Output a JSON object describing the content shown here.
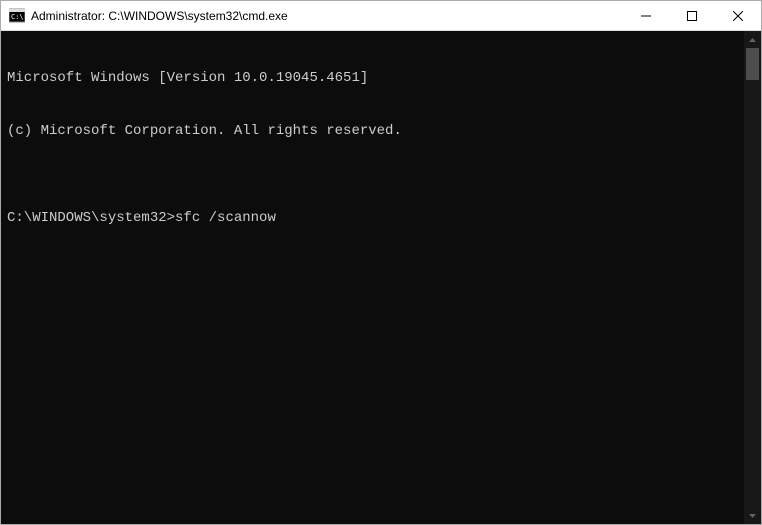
{
  "titlebar": {
    "title": "Administrator: C:\\WINDOWS\\system32\\cmd.exe"
  },
  "terminal": {
    "line1": "Microsoft Windows [Version 10.0.19045.4651]",
    "line2": "(c) Microsoft Corporation. All rights reserved.",
    "blank": "",
    "prompt": "C:\\WINDOWS\\system32>",
    "command": "sfc /scannow"
  }
}
